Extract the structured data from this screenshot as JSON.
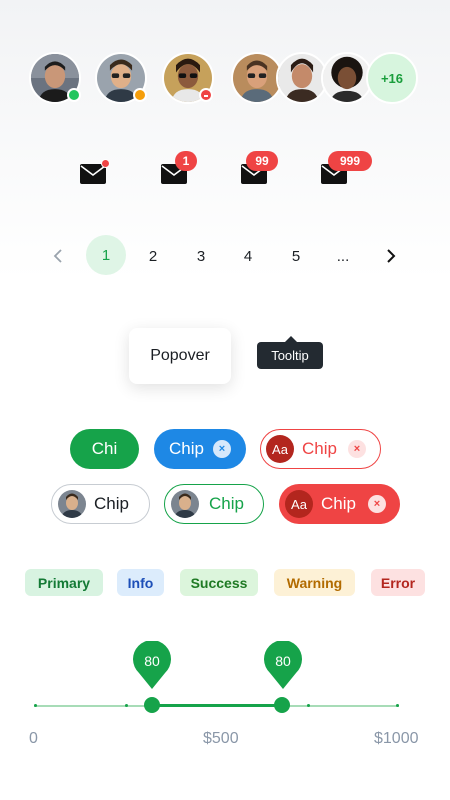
{
  "avatars": {
    "single": [
      {
        "name": "avatar-online",
        "status": "online",
        "status_color": "#22c55e"
      },
      {
        "name": "avatar-away",
        "status": "away",
        "status_color": "#f59e0b"
      },
      {
        "name": "avatar-busy",
        "status": "busy",
        "status_color": "#ef4444"
      }
    ],
    "group_more": "+16"
  },
  "badges": [
    {
      "type": "dot",
      "icon": "mail-icon"
    },
    {
      "type": "count",
      "value": "1",
      "icon": "mail-icon"
    },
    {
      "type": "count",
      "value": "99",
      "icon": "mail-icon"
    },
    {
      "type": "count",
      "value": "999",
      "icon": "mail-icon"
    }
  ],
  "pagination": {
    "prev_icon": "chevron-left-icon",
    "pages": [
      "1",
      "2",
      "3",
      "4",
      "5",
      "..."
    ],
    "active": "1",
    "next_icon": "chevron-right-icon"
  },
  "popover": {
    "label": "Popover"
  },
  "tooltip": {
    "label": "Tooltip"
  },
  "chips": {
    "row1": [
      {
        "label": "Chi",
        "style": "filled-green"
      },
      {
        "label": "Chip",
        "style": "filled-blue",
        "deletable": true
      },
      {
        "label": "Chip",
        "style": "outlined-red",
        "avatar_text": "Aa",
        "deletable": true
      }
    ],
    "row2": [
      {
        "label": "Chip",
        "style": "outlined-gray",
        "avatar": "photo"
      },
      {
        "label": "Chip",
        "style": "outlined-green",
        "avatar": "photo"
      },
      {
        "label": "Chip",
        "style": "filled-red",
        "avatar_text": "Aa",
        "deletable": true
      }
    ]
  },
  "labels": [
    {
      "label": "Primary",
      "bg": "#d8f3e1",
      "fg": "#137a35"
    },
    {
      "label": "Info",
      "bg": "#dcecfc",
      "fg": "#1d4fb8"
    },
    {
      "label": "Success",
      "bg": "#dcf5dc",
      "fg": "#1f7a24"
    },
    {
      "label": "Warning",
      "bg": "#fdf1d6",
      "fg": "#b26b00"
    },
    {
      "label": "Error",
      "bg": "#fde1e1",
      "fg": "#b3261e"
    }
  ],
  "slider": {
    "min_label": "0",
    "mid_label": "$500",
    "max_label": "$1000",
    "values": [
      80,
      80
    ],
    "accent": "#16a34a"
  },
  "colors": {
    "green": "#16a34a",
    "blue": "#1e88e5",
    "red": "#ef4444"
  }
}
